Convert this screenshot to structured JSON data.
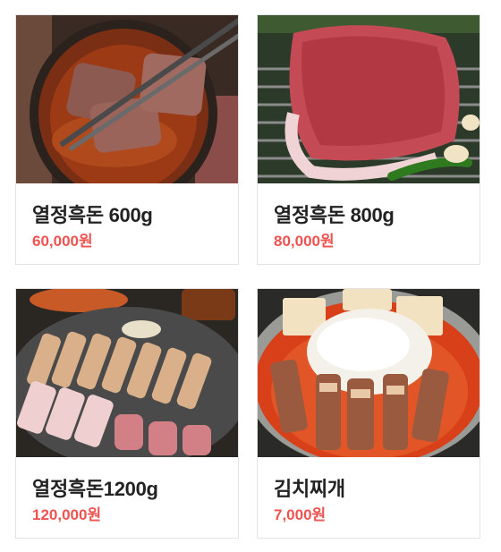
{
  "menu": {
    "items": [
      {
        "name": "열정흑돈 600g",
        "price": "60,000원",
        "image": "grilled-pork-in-sauce-bowl"
      },
      {
        "name": "열정흑돈 800g",
        "price": "80,000원",
        "image": "raw-pork-block-on-grill"
      },
      {
        "name": "열정흑돈1200g",
        "price": "120,000원",
        "image": "pork-belly-on-grill-platter"
      },
      {
        "name": "김치찌개",
        "price": "7,000원",
        "image": "kimchi-stew-with-rice"
      }
    ]
  },
  "colors": {
    "price": "#ef5350",
    "name": "#222222",
    "border": "#e3e3e3"
  }
}
